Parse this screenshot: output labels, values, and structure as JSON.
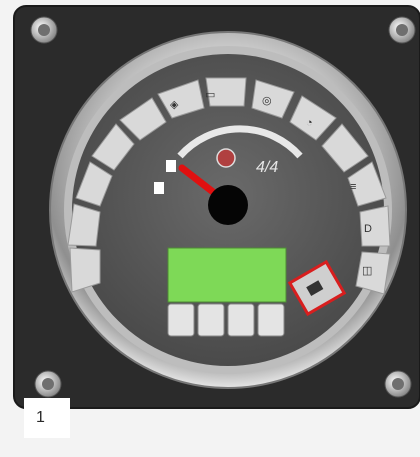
{
  "image": {
    "description_label": "Instrument cluster dashboard"
  },
  "gauge": {
    "fuel_fraction": "4/4",
    "caption_number": "1",
    "screen_color": "#7ed957",
    "highlight_color": "#d81e1e",
    "needle_color": "#e01010"
  }
}
